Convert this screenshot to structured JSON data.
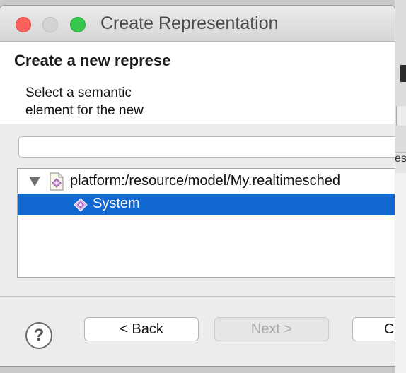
{
  "window": {
    "title": "Create Representation"
  },
  "header": {
    "title": "Create a new represe",
    "description_line1": "Select a semantic",
    "description_line2": "element for the new"
  },
  "search": {
    "value": "",
    "placeholder": ""
  },
  "tree": {
    "root": {
      "label": "platform:/resource/model/My.realtimesched",
      "icon": "model-file-icon",
      "expanded": true
    },
    "children": [
      {
        "label": "System",
        "icon": "system-element-icon",
        "selected": true
      }
    ]
  },
  "buttons": {
    "help": "?",
    "back": "< Back",
    "next": "Next >",
    "cancel": "C"
  },
  "background": {
    "fragment_text": "es"
  },
  "colors": {
    "selection": "#1268d1",
    "close": "#fc605c",
    "maximize": "#34c84a"
  }
}
